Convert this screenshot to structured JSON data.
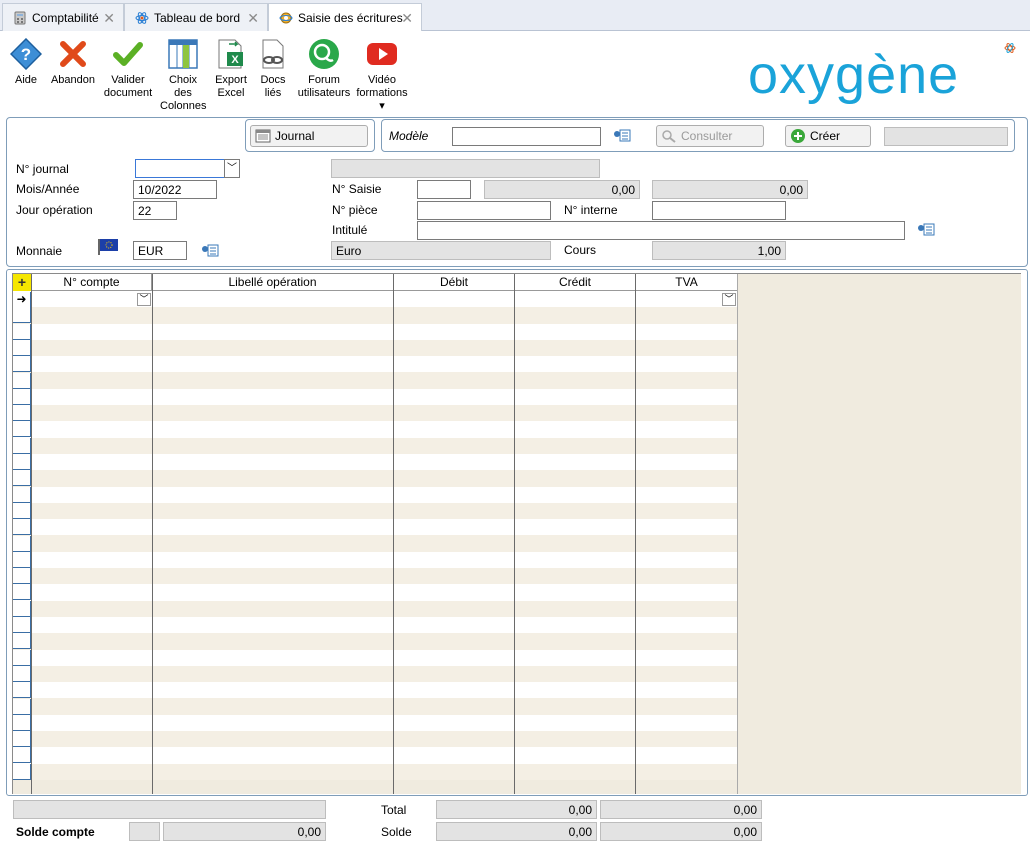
{
  "tabs": [
    {
      "label": "Comptabilité",
      "icon": "calculator-icon"
    },
    {
      "label": "Tableau de bord",
      "icon": "atom-icon"
    },
    {
      "label": "Saisie des écritures",
      "icon": "gear-atom-icon"
    }
  ],
  "toolbar": [
    {
      "label1": "Aide",
      "label2": "",
      "label3": "",
      "icon": "help-diamond-icon"
    },
    {
      "label1": "Abandon",
      "label2": "",
      "label3": "",
      "icon": "cross-icon"
    },
    {
      "label1": "Valider",
      "label2": "document",
      "label3": "",
      "icon": "check-icon"
    },
    {
      "label1": "Choix",
      "label2": "des",
      "label3": "Colonnes",
      "icon": "columns-icon"
    },
    {
      "label1": "Export",
      "label2": "Excel",
      "label3": "",
      "icon": "excel-export-icon"
    },
    {
      "label1": "Docs",
      "label2": "liés",
      "label3": "",
      "icon": "linked-docs-icon"
    },
    {
      "label1": "Forum",
      "label2": "utilisateurs",
      "label3": "",
      "icon": "forum-icon"
    },
    {
      "label1": "Vidéo",
      "label2": "formations",
      "label3": "▾",
      "icon": "video-play-icon"
    }
  ],
  "logo": {
    "text": "oxygène"
  },
  "colors": {
    "accent": "#1aa3d9",
    "tabbar": "#e8ecf4",
    "panel_border": "#7f9db9",
    "grid_bg": "#f0ebdf"
  },
  "header": {
    "journal_button": "Journal",
    "modele_label": "Modèle",
    "modele_value": "",
    "consulter_button": "Consulter",
    "creer_button": "Créer"
  },
  "form": {
    "n_journal_label": "N° journal",
    "n_journal_value": "",
    "mois_annee_label": "Mois/Année",
    "mois_annee_value": "10/2022",
    "jour_operation_label": "Jour opération",
    "jour_operation_value": "22",
    "monnaie_label": "Monnaie",
    "monnaie_value": "EUR",
    "n_saisie_label": "N° Saisie",
    "n_saisie_value": "",
    "n_saisie_amount1": "0,00",
    "n_saisie_amount2": "0,00",
    "n_piece_label": "N° pièce",
    "n_piece_value": "",
    "n_interne_label": "N° interne",
    "n_interne_value": "",
    "intitule_label": "Intitulé",
    "intitule_value": "",
    "devise_name": "Euro",
    "cours_label": "Cours",
    "cours_value": "1,00"
  },
  "grid": {
    "columns": [
      "N° compte",
      "Libellé opération",
      "Débit",
      "Crédit",
      "TVA"
    ],
    "rows": []
  },
  "footer": {
    "total_label": "Total",
    "total_debit": "0,00",
    "total_credit": "0,00",
    "solde_compte_label": "Solde compte",
    "solde_compte_value": "0,00",
    "solde_label": "Solde",
    "solde_debit": "0,00",
    "solde_credit": "0,00"
  }
}
